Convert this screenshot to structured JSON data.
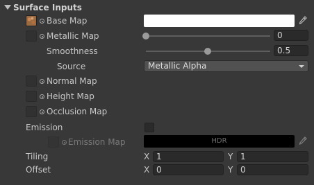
{
  "section": {
    "title": "Surface Inputs"
  },
  "properties": {
    "base_map": {
      "label": "Base Map",
      "color": "#ffffff"
    },
    "metallic_map": {
      "label": "Metallic Map",
      "value": "0",
      "slider_fraction": 0.0
    },
    "smoothness": {
      "label": "Smoothness",
      "value": "0.5",
      "slider_fraction": 0.5
    },
    "source": {
      "label": "Source",
      "selected": "Metallic Alpha"
    },
    "normal_map": {
      "label": "Normal Map"
    },
    "height_map": {
      "label": "Height Map"
    },
    "occlusion_map": {
      "label": "Occlusion Map"
    },
    "emission": {
      "label": "Emission",
      "checked": false
    },
    "emission_map": {
      "label": "Emission Map",
      "hdr_label": "HDR",
      "color": "#000000"
    },
    "tiling": {
      "label": "Tiling",
      "x_label": "X",
      "x": "1",
      "y_label": "Y",
      "y": "1"
    },
    "offset": {
      "label": "Offset",
      "x_label": "X",
      "x": "0",
      "y_label": "Y",
      "y": "0"
    }
  },
  "icons": {
    "foldout": "triangle-down-icon",
    "texture_slot": "texture-slot-icon",
    "object_picker": "object-picker-icon",
    "eyedropper": "eyedropper-icon",
    "dropdown": "chevron-down-icon"
  }
}
